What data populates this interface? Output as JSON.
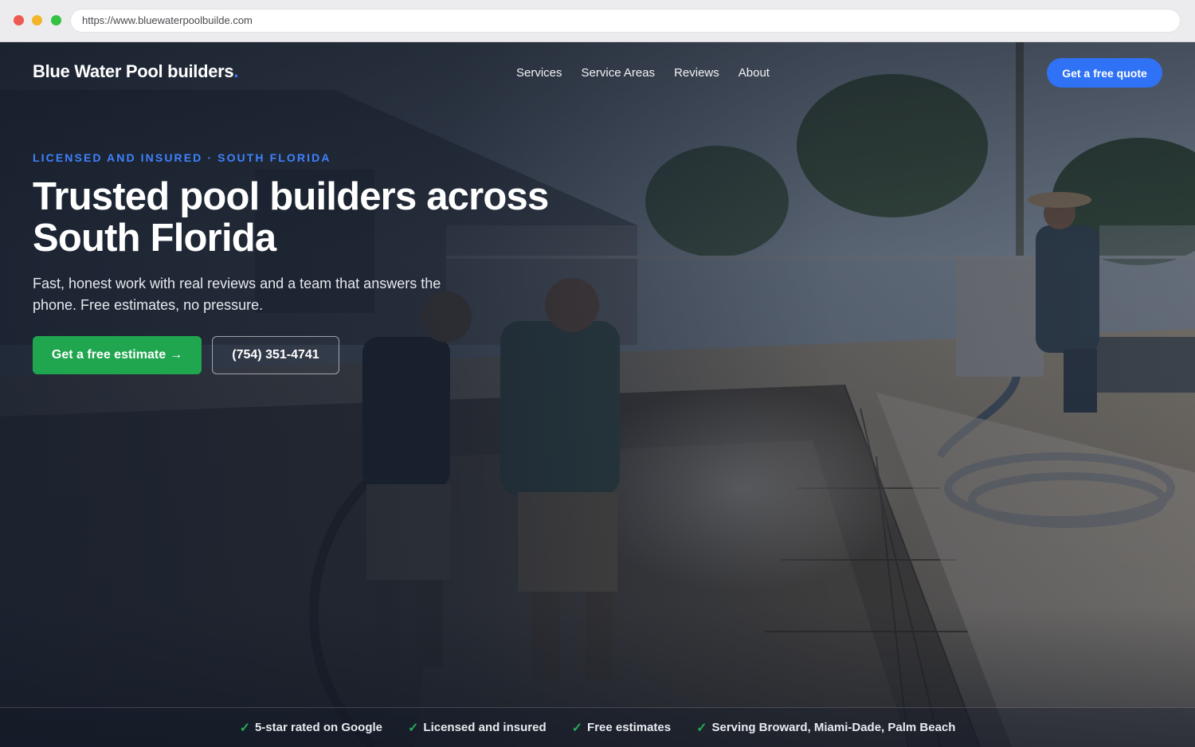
{
  "browser": {
    "url": "https://www.bluewaterpoolbuilde.com"
  },
  "header": {
    "logo_text": "Blue Water Pool builders",
    "logo_dot": ".",
    "nav": [
      {
        "label": "Services"
      },
      {
        "label": "Service Areas"
      },
      {
        "label": "Reviews"
      },
      {
        "label": "About"
      }
    ],
    "quote_button": "Get a free quote"
  },
  "hero": {
    "eyebrow": "LICENSED AND INSURED · SOUTH FLORIDA",
    "headline_line1": "Trusted pool builders across",
    "headline_line2": "South Florida",
    "subtext": "Fast, honest work with real reviews and a team that answers the phone. Free estimates, no pressure.",
    "cta_primary": "Get a free estimate",
    "cta_arrow": "→",
    "cta_phone": "(754) 351-4741",
    "background_image": "workers spraying shotcrete into a pool excavation"
  },
  "trust_bar": {
    "check_icon": "✓",
    "items": [
      {
        "label": "5-star rated on Google"
      },
      {
        "label": "Licensed and insured"
      },
      {
        "label": "Free estimates"
      },
      {
        "label": "Serving Broward, Miami-Dade, Palm Beach"
      }
    ]
  },
  "colors": {
    "accent_blue": "#2f72f5",
    "eyebrow_blue": "#3e82ff",
    "cta_green": "#20a64f",
    "check_green": "#24a853"
  }
}
